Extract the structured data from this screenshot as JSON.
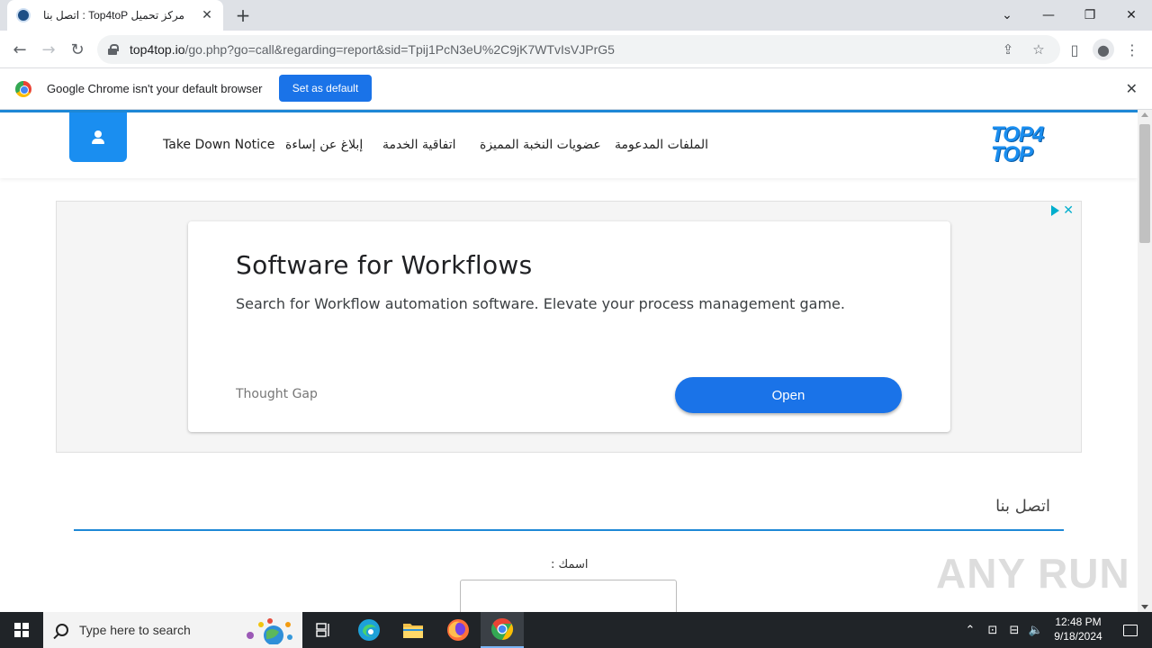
{
  "browser": {
    "tab_title": "مركز تحميل Top4toP : اتصل بنا",
    "url_host": "top4top.io",
    "url_path": "/go.php?go=call&regarding=report&sid=Tpij1PcN3eU%2C9jK7WTvIsVJPrG5",
    "infobar_text": "Google Chrome isn't your default browser",
    "set_default_label": "Set as default"
  },
  "site": {
    "logo_line1": "TOP4",
    "logo_line2": "TOP",
    "nav": [
      {
        "label": "الملفات المدعومة"
      },
      {
        "label": "عضويات النخبة المميزة"
      },
      {
        "label": "اتفاقية الخدمة"
      },
      {
        "label": "إبلاغ عن إساءة"
      },
      {
        "label": "Take Down Notice"
      }
    ]
  },
  "ad": {
    "headline": "Software for Workflows",
    "description": "Search for Workflow automation software. Elevate your process management game.",
    "advertiser": "Thought Gap",
    "cta": "Open"
  },
  "contact": {
    "title": "اتصل بنا",
    "name_label": "اسمك :",
    "name_value": ""
  },
  "watermark": "ANY RUN",
  "taskbar": {
    "search_placeholder": "Type here to search",
    "time": "12:48 PM",
    "date": "9/18/2024"
  },
  "colors": {
    "accent": "#1a8ef0",
    "chrome_blue": "#1a73e8",
    "taskbar": "#202428"
  }
}
